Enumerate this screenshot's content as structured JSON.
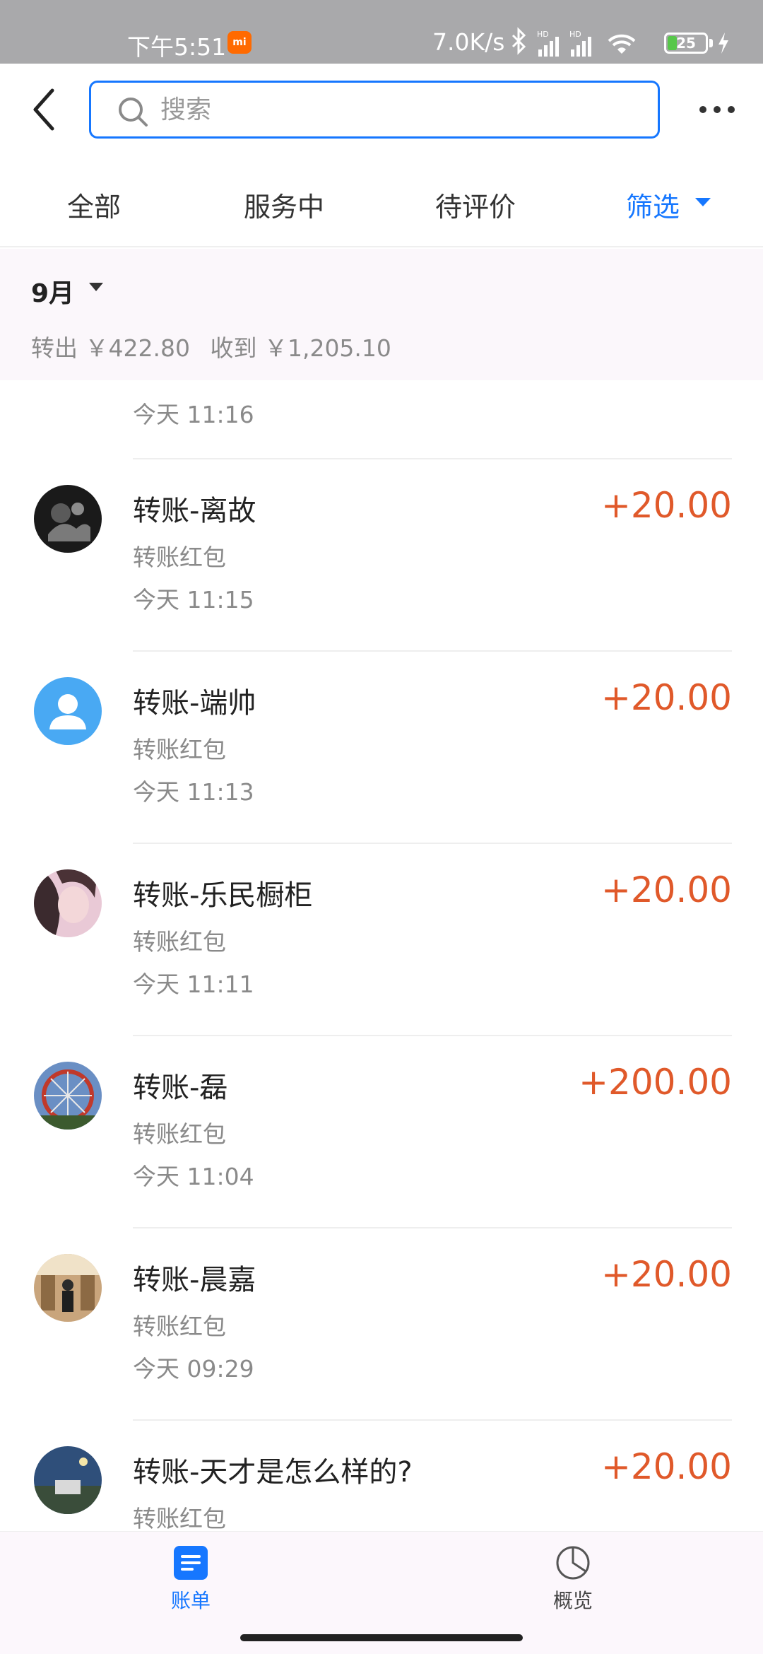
{
  "status_bar": {
    "time": "下午5:51",
    "carrier_badge": "mi",
    "network_speed": "7.0K/s",
    "icons": [
      "bluetooth-icon",
      "hd-signal-icon",
      "hd-signal-icon",
      "wifi-icon",
      "battery-icon",
      "charging-bolt-icon"
    ],
    "battery_level": "25"
  },
  "header": {
    "back_icon": "chevron-left-icon",
    "search_placeholder": "搜索",
    "more_icon": "ellipsis-icon"
  },
  "tabs": [
    {
      "label": "全部"
    },
    {
      "label": "服务中"
    },
    {
      "label": "待评价"
    },
    {
      "label": "筛选",
      "active_color": "#1677ff"
    }
  ],
  "month_summary": {
    "month": "9月",
    "outgoing": "转出 ￥422.80",
    "incoming": "收到 ￥1,205.10"
  },
  "list": {
    "top_partial_time": "今天  11:16",
    "items": [
      {
        "title": "转账-离故",
        "subtitle": "转账红包",
        "time": "今天  11:15",
        "amount": "+20.00",
        "avatar": "dark-photo-avatar"
      },
      {
        "title": "转账-端帅",
        "subtitle": "转账红包",
        "time": "今天  11:13",
        "amount": "+20.00",
        "avatar": "default-user-avatar"
      },
      {
        "title": "转账-乐民橱柜",
        "subtitle": "转账红包",
        "time": "今天  11:11",
        "amount": "+20.00",
        "avatar": "portrait-photo-avatar"
      },
      {
        "title": "转账-磊",
        "subtitle": "转账红包",
        "time": "今天  11:04",
        "amount": "+200.00",
        "avatar": "ferris-wheel-avatar"
      },
      {
        "title": "转账-晨嘉",
        "subtitle": "转账红包",
        "time": "今天  09:29",
        "amount": "+20.00",
        "avatar": "room-photo-avatar"
      },
      {
        "title": "转账-天才是怎么样的?",
        "subtitle": "转账红包",
        "time": "",
        "amount": "+20.00",
        "avatar": "landscape-photo-avatar"
      }
    ],
    "amount_color": "#e0592a"
  },
  "bottom_nav": [
    {
      "label": "账单",
      "icon": "bill-icon",
      "active": true
    },
    {
      "label": "概览",
      "icon": "pie-chart-icon",
      "active": false
    }
  ],
  "colors": {
    "accent": "#1677ff",
    "amount": "#e0592a",
    "status_bar_bg": "#a9a9ab",
    "summary_bg": "#fbf7fb"
  }
}
